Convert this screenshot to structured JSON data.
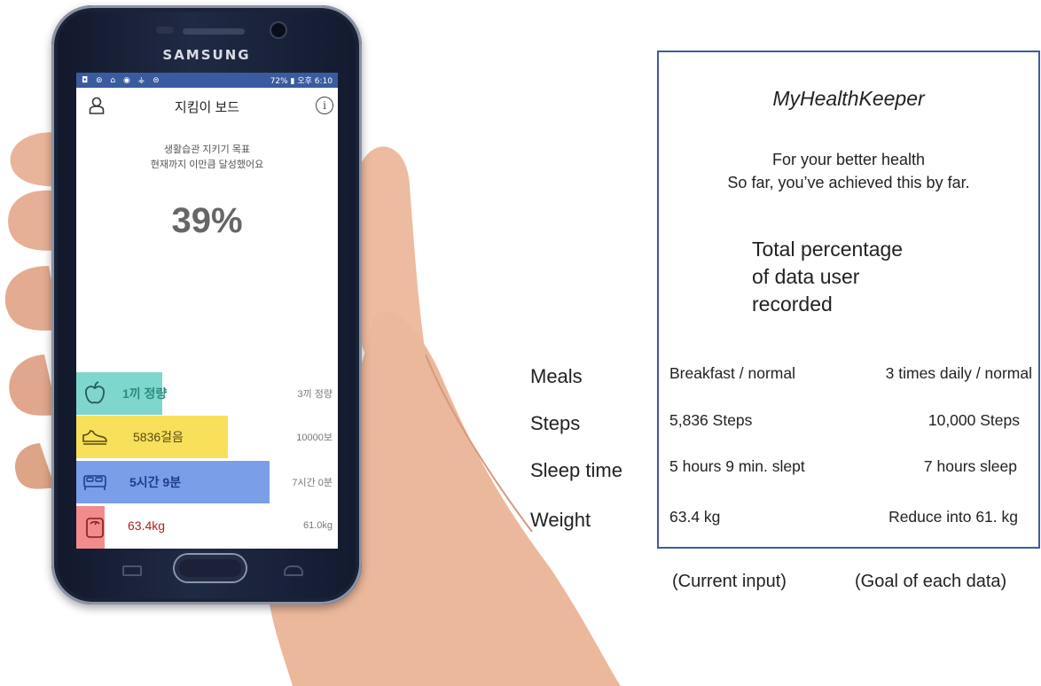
{
  "phone": {
    "brand": "SAMSUNG",
    "status_bar": {
      "left_icons": "◘ ⊚ ⌂ ◉ ⚶ ⊜",
      "right_text": "72% ▮ 오후 6:10"
    },
    "app": {
      "title": "지킴이 보드",
      "goal_line1": "생활습관 지키기 목표",
      "goal_line2": "현재까지 이만큼 달성했어요",
      "percent": "39%",
      "percent_value": 0.39,
      "metrics": [
        {
          "icon": "apple-icon",
          "current": "1끼 정량",
          "goal": "3끼 정량",
          "progress": 0.33,
          "color": "#7fd6cc",
          "text_color": "#2a8c80"
        },
        {
          "icon": "shoe-icon",
          "current": "5836걸음",
          "goal": "10000보",
          "progress": 0.58,
          "color": "#f7e05a",
          "text_color": "#5a4a10"
        },
        {
          "icon": "bed-icon",
          "current": "5시간 9분",
          "goal": "7시간 0분",
          "progress": 0.74,
          "color": "#7a9ee8",
          "text_color": "#1f3c8a"
        },
        {
          "icon": "scale-icon",
          "current": "63.4kg",
          "goal": "61.0kg",
          "progress": 0.11,
          "color": "#f08c8c",
          "text_color": "#b02020"
        }
      ]
    }
  },
  "explanation": {
    "app_name": "MyHealthKeeper",
    "tagline_line1": "For your better health",
    "tagline_line2": "So far, you’ve achieved this by far.",
    "pct_desc_line1": "Total percentage",
    "pct_desc_line2": "of data user",
    "pct_desc_line3": "recorded",
    "rows": [
      {
        "label": "Meals",
        "current": "Breakfast / normal",
        "goal": "3 times daily / normal"
      },
      {
        "label": "Steps",
        "current": "5,836 Steps",
        "goal": "10,000 Steps"
      },
      {
        "label": "Sleep time",
        "current": "5 hours 9 min. slept",
        "goal": "7 hours sleep"
      },
      {
        "label": "Weight",
        "current": "63.4 kg",
        "goal": "Reduce into 61. kg"
      }
    ],
    "current_caption": "(Current input)",
    "goal_caption": "(Goal of each data)"
  }
}
